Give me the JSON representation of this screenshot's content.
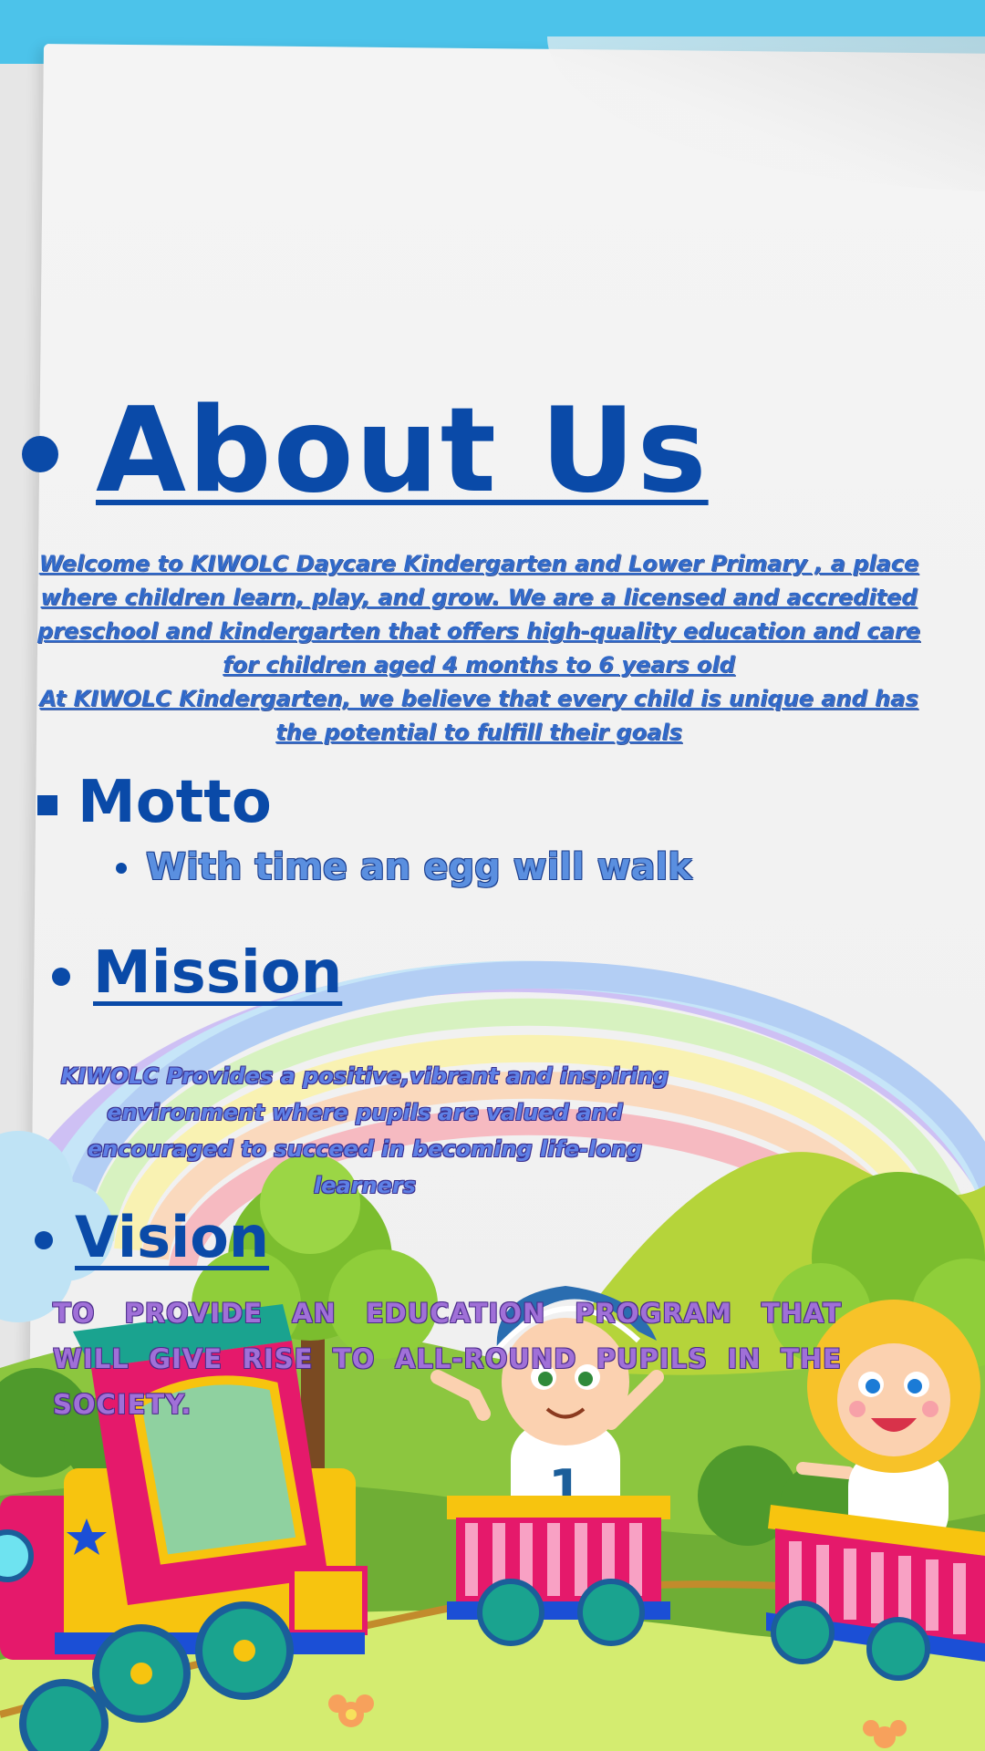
{
  "about": {
    "title": "About Us",
    "body": "Welcome to KIWOLC Daycare  Kindergarten and Lower Primary , a place where children learn, play, and grow. We are a licensed and accredited preschool and kindergarten that offers high-quality education and care for children aged 4 months to 6 years old\nAt KIWOLC Kindergarten, we believe that every child is unique and has the potential to fulfill their goals "
  },
  "motto": {
    "title": "Motto",
    "item": "With time an egg will walk"
  },
  "mission": {
    "title": "Mission ",
    "body": "KIWOLC Provides a positive,vibrant and inspiring environment where pupils are valued and encouraged to succeed in becoming life-long learners"
  },
  "vision": {
    "title": "Vision ",
    "body": "TO PROVIDE AN EDUCATION PROGRAM THAT WILL GIVE RISE TO ALL-ROUND PUPILS IN THE SOCIETY."
  },
  "colors": {
    "sky": "#4cc3ea",
    "heading": "#0a4aa8",
    "body_text": "#2f68c8",
    "vision_text": "#a070d8"
  },
  "illustration": {
    "name": "rainbow-train-kids-illustration",
    "jersey_number": "1"
  }
}
